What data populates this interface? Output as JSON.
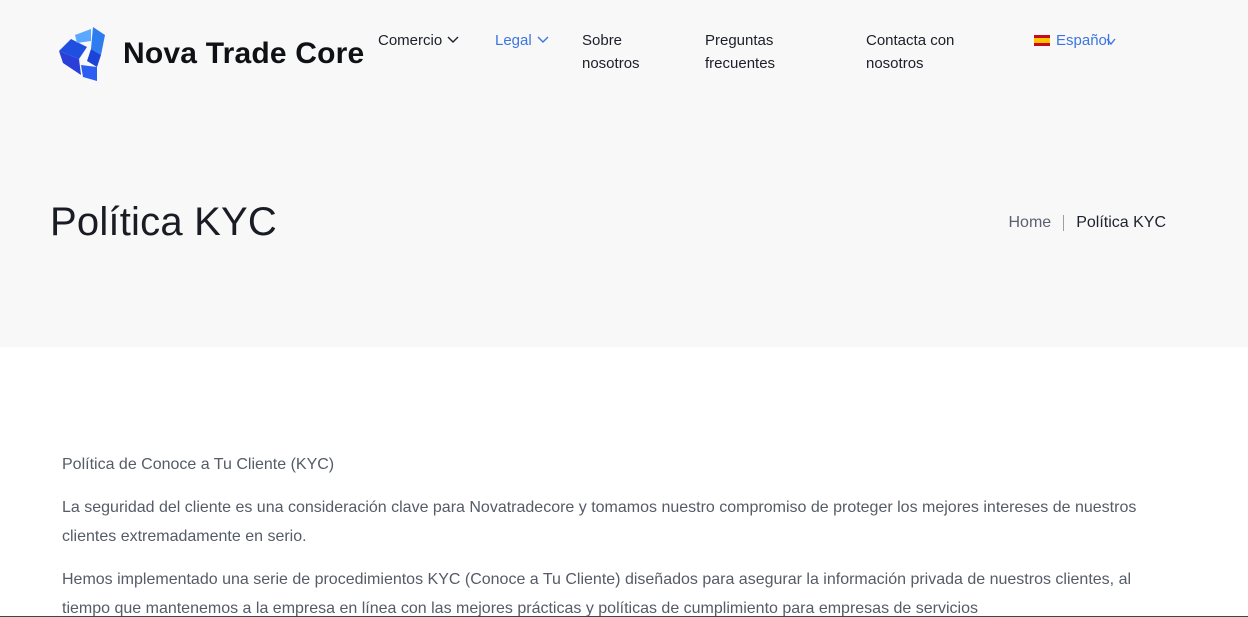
{
  "brand": {
    "name": "Nova Trade Core",
    "logo_icon": "cube-logo-icon"
  },
  "nav": {
    "items": [
      {
        "label": "Comercio",
        "has_dropdown": true,
        "active": false
      },
      {
        "label": "Legal",
        "has_dropdown": true,
        "active": true
      },
      {
        "label_lines": [
          "Sobre",
          "nosotros"
        ]
      },
      {
        "label_lines": [
          "Preguntas",
          "frecuentes"
        ]
      },
      {
        "label_lines": [
          "Contacta con",
          "nosotros"
        ]
      }
    ],
    "language": {
      "label": "Español",
      "flag": "spain-flag-icon"
    }
  },
  "page": {
    "title": "Política KYC",
    "breadcrumb": {
      "home": "Home",
      "current": "Política KYC"
    }
  },
  "content": {
    "paragraphs": [
      "Política de Conoce a Tu Cliente (KYC)",
      "La seguridad del cliente es una consideración clave para Novatradecore y tomamos nuestro compromiso de proteger los mejores intereses de nuestros clientes extremadamente en serio.",
      "Hemos implementado una serie de procedimientos KYC (Conoce a Tu Cliente) diseñados para asegurar la información privada de nuestros clientes, al tiempo que mantenemos a la empresa en línea con las mejores prácticas y políticas de cumplimiento para empresas de servicios"
    ]
  },
  "colors": {
    "accent": "#3b76e0",
    "hero_bg": "#f8f8f8",
    "body_text": "#555b67",
    "logo_blue": "#1f4fe0"
  }
}
